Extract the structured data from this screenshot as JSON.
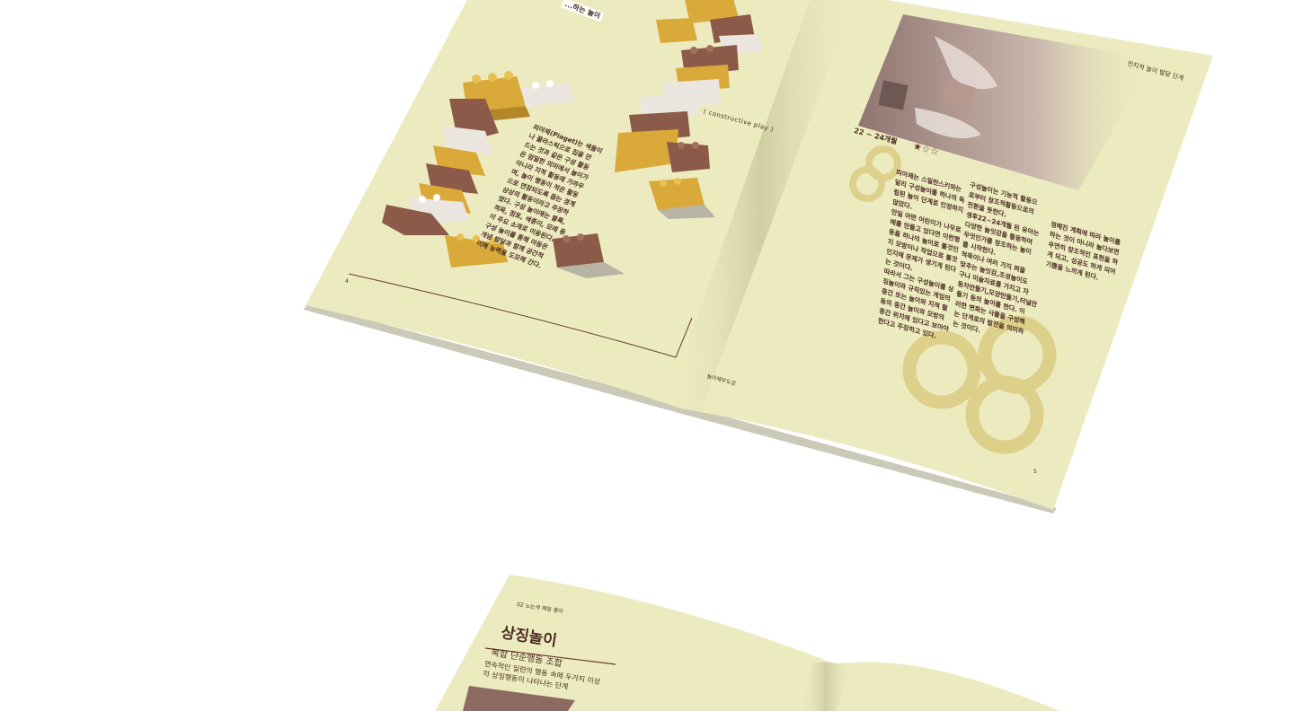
{
  "spread_top": {
    "left_page": {
      "top_caption": "...하는 놀이",
      "paragraph": "피아제(Piaget)는 색들이\n나 플라스틱으로 집을 만\n드는 것과 같은 구성 활동\n은 엄밀한 의미에서 놀이가\n아니라 지적 활동에 가까우\n며, 놀이 행동이 적은 활동\n으로 연장되도록 돕는 경계\n상상의 활동이라고 주장하\n였다. 구성 놀이에는 블록,\n적목, 점토, 색종이, 모래 등\n이 주요 소재로 이용된다.\n구성 놀이를 통해 아동은\n개념 발달과 함께 공간적\n이해 능력을 도모해 간다.",
      "tag": "( constructive play )",
      "page_number": "4"
    },
    "right_page": {
      "running_header": "인지적 놀이 발달 단계",
      "age_label": "22 ~ 24개월",
      "stars": "★☆☆",
      "col1": "피아제는 스밀란스키와는\n달리 구성놀이를 하나의 독\n립된 놀이 단계로 인정하지\n않았다.\n만일 어떤 어린이가 나무로\n배를 만들고 있다면 이런행\n동을 하나의 놀이로 볼것인\n지 모방이나 작업으로 볼것\n인지에 문제가 생기게 된다\n는 것이다.\n따라서 그는 구성놀이를 상\n징놀이와 규칙있는 게임의\n중간 또는 놀이와 지적 활\n동의 중간 놀이와 모방의\n중간 위치에 있다고 보아야\n한다고 주장하고 있다.",
      "col2": "구성놀이는 기능적 활동으\n로부터 창조적활동으로의\n전환을 뜻한다.\n생후22~24개월 된 유아는\n다양한 놀잇감을 활용하여\n무엇인가를 창조하는 놀이\n를 시작한다.\n적목이나 여러 가지 퍼즐\n맞추는 놀잇감,조성놀이도\n구나 미술자료를 가지고 자\n동차만들기,모양만들기,터널만\n들기 등의 놀이를 한다. 이\n러한 변화는 사물을 구성해\n는 단계로의 발전을 의미하\n는 것이다.",
      "col3": "정해진 계획에 따라 놀이를\n하는 것이 아니라 놀다보면\n우연히 창조적인 표현을 하\n게 되고, 성공도 하게 되어\n기쁨을 느끼게 된다.",
      "footer_left": "놀이해부도감",
      "page_number": "5"
    }
  },
  "spread_bottom": {
    "section_label": "02 노는게 제일 좋아",
    "title": "상징놀이",
    "subtitle": "복합 단순행동 조합",
    "desc": "연속적인 일련의 행동 속에 두가지 이상\n의 상징행동이 나타나는 단계"
  },
  "colors": {
    "paper": "#ecebbf",
    "ink": "#4a2a22",
    "brick_brown": "#8c5a48",
    "brick_gold": "#d9a93a",
    "brick_white": "#ece6e0",
    "ring_gold": "#ddd08a"
  }
}
